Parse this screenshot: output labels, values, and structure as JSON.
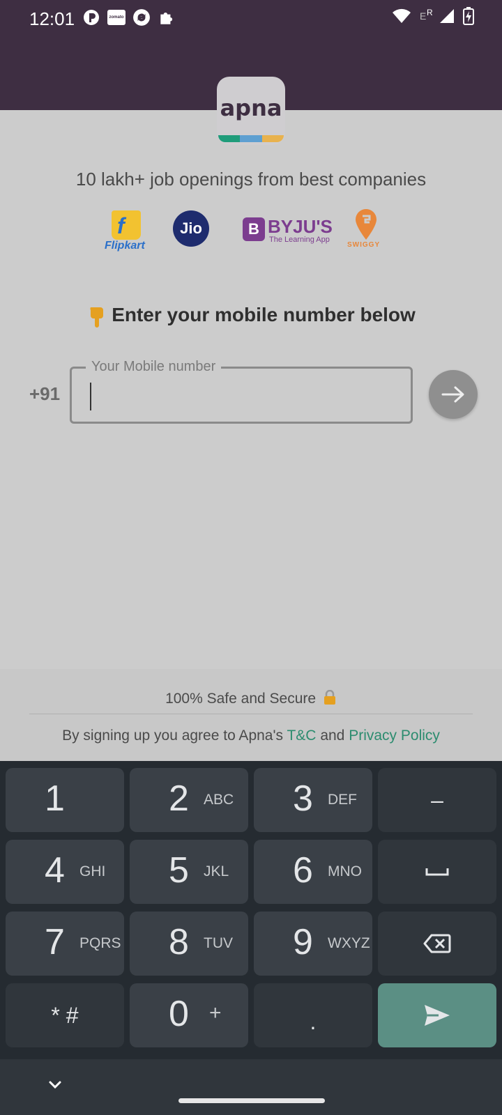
{
  "status_bar": {
    "time": "12:01",
    "left_icons": [
      "app-icon-circle",
      "zomato-icon",
      "sync-icon",
      "puzzle-icon"
    ],
    "zomato_text": "zomato",
    "network_letters": [
      "E",
      "R"
    ],
    "right_icons": [
      "wifi-icon",
      "signal-icon",
      "battery-charging-icon"
    ]
  },
  "logo": {
    "text": "apna",
    "stripe_colors": [
      "#1f9c7a",
      "#5e9fd1",
      "#e8b24e"
    ]
  },
  "headline": "10 lakh+ job openings from best companies",
  "partners": {
    "flipkart": "Flipkart",
    "flipkart_letter": "f",
    "jio": "Jio",
    "byjus": "BYJU'S",
    "byjus_letter": "B",
    "byjus_sub": "The Learning App",
    "swiggy": "SWIGGY"
  },
  "form": {
    "prompt": "Enter your mobile number below",
    "country_code": "+91",
    "label": "Your Mobile number",
    "value": ""
  },
  "footer": {
    "safe_text": "100% Safe and Secure",
    "terms_prefix": "By signing up you agree to Apna's",
    "tc_link": "T&C",
    "and": "and",
    "privacy_link": "Privacy Policy"
  },
  "keyboard": {
    "keys": [
      {
        "num": "1",
        "letters": ""
      },
      {
        "num": "2",
        "letters": "ABC"
      },
      {
        "num": "3",
        "letters": "DEF"
      },
      {
        "num": "4",
        "letters": "GHI"
      },
      {
        "num": "5",
        "letters": "JKL"
      },
      {
        "num": "6",
        "letters": "MNO"
      },
      {
        "num": "7",
        "letters": "PQRS"
      },
      {
        "num": "8",
        "letters": "TUV"
      },
      {
        "num": "9",
        "letters": "WXYZ"
      },
      {
        "num": "0",
        "letters": "+"
      }
    ],
    "dash": "–",
    "star_hash": "* #",
    "dot": "."
  },
  "colors": {
    "header_bg": "#3e2e42",
    "link": "#2c8c6f",
    "enter_key": "#5b8f84"
  }
}
